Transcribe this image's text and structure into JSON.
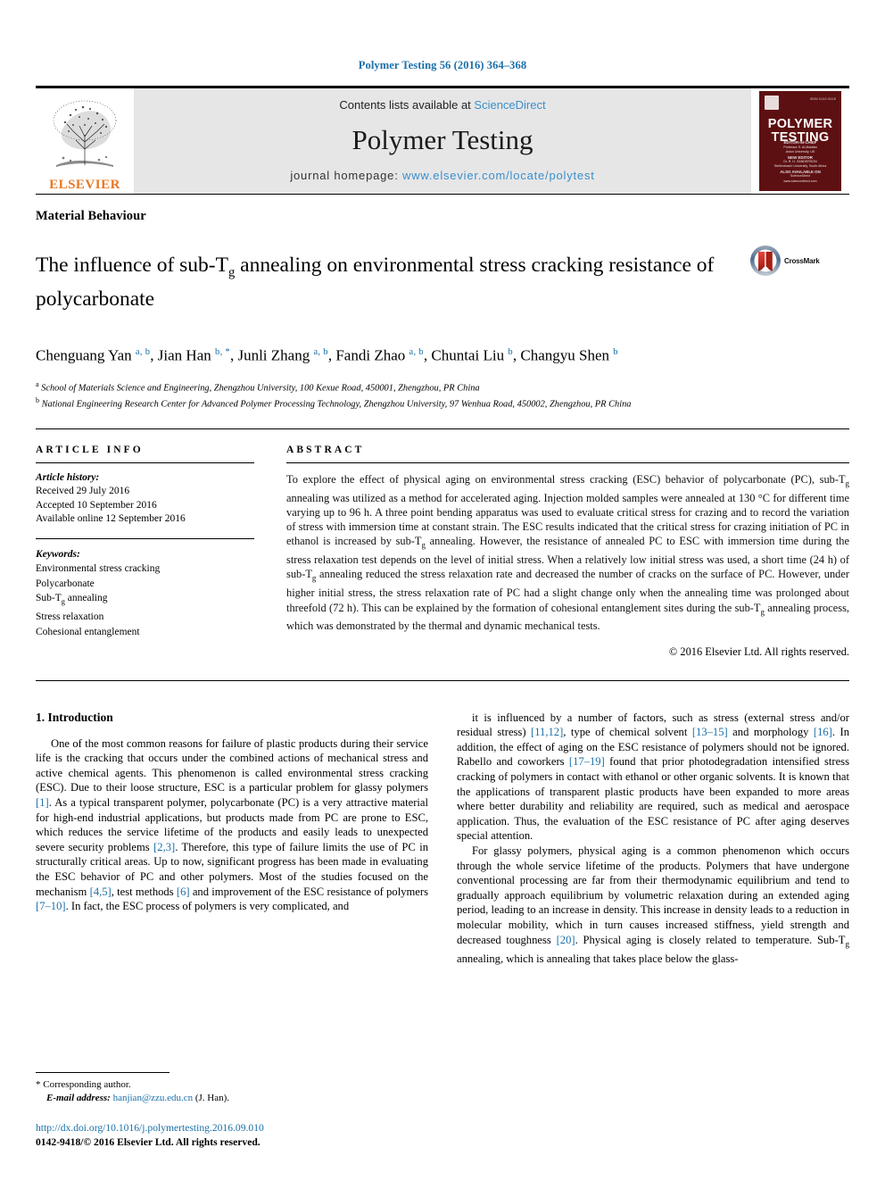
{
  "running_head": "Polymer Testing 56 (2016) 364–368",
  "masthead": {
    "elsevier_wordmark": "ELSEVIER",
    "contents_prefix": "Contents lists available at ",
    "sciencedirect": "ScienceDirect",
    "journal_title": "Polymer Testing",
    "homepage_prefix": "journal homepage: ",
    "homepage_url": "www.elsevier.com/locate/polytest",
    "cover": {
      "title_line1": "POLYMER",
      "title_line2": "TESTING",
      "issn_text": "ISSN 0142-9418",
      "credit1": "EDITOR-IN-CHIEF",
      "credit2": "Professor S. Al-Malaika",
      "credit3": "Aston University, UK",
      "credit4": "NEW EDITOR",
      "credit5": "Dr. R. D. SANDERSON",
      "credit6": "Stellenbosch University, South Africa",
      "credit7": "ALSO AVAILABLE ON",
      "credit8": "ScienceDirect",
      "credit9": "www.sciencedirect.com"
    }
  },
  "kicker": "Material Behaviour",
  "title": {
    "part1": "The influence of sub-T",
    "sub": "g",
    "part2": " annealing on environmental stress cracking resistance of polycarbonate"
  },
  "crossmark_label": "CrossMark",
  "authors": [
    {
      "name": "Chenguang Yan",
      "sup": "a, b",
      "sep": ", "
    },
    {
      "name": "Jian Han",
      "sup": "b, *",
      "sep": ", "
    },
    {
      "name": "Junli Zhang",
      "sup": "a, b",
      "sep": ", "
    },
    {
      "name": "Fandi Zhao",
      "sup": "a, b",
      "sep": ", "
    },
    {
      "name": "Chuntai Liu",
      "sup": "b",
      "sep": ", "
    },
    {
      "name": "Changyu Shen",
      "sup": "b",
      "sep": ""
    }
  ],
  "affiliations": [
    {
      "marker": "a",
      "text": "School of Materials Science and Engineering, Zhengzhou University, 100 Kexue Road, 450001, Zhengzhou, PR China"
    },
    {
      "marker": "b",
      "text": "National Engineering Research Center for Advanced Polymer Processing Technology, Zhengzhou University, 97 Wenhua Road, 450002, Zhengzhou, PR China"
    }
  ],
  "article_info": {
    "heading": "ARTICLE INFO",
    "history_label": "Article history:",
    "history": [
      "Received 29 July 2016",
      "Accepted 10 September 2016",
      "Available online 12 September 2016"
    ],
    "keywords_label": "Keywords:",
    "keywords": [
      "Environmental stress cracking",
      "Polycarbonate",
      "Sub-Tg annealing",
      "Stress relaxation",
      "Cohesional entanglement"
    ]
  },
  "abstract": {
    "heading": "ABSTRACT",
    "text_p1": "To explore the effect of physical aging on environmental stress cracking (ESC) behavior of polycarbonate (PC), sub-Tg annealing was utilized as a method for accelerated aging. Injection molded samples were annealed at 130 °C for different time varying up to 96 h. A three point bending apparatus was used to evaluate critical stress for crazing and to record the variation of stress with immersion time at constant strain. The ESC results indicated that the critical stress for crazing initiation of PC in ethanol is increased by sub-Tg annealing. However, the resistance of annealed PC to ESC with immersion time during the stress relaxation test depends on the level of initial stress. When a relatively low initial stress was used, a short time (24 h) of sub-Tg annealing reduced the stress relaxation rate and decreased the number of cracks on the surface of PC. However, under higher initial stress, the stress relaxation rate of PC had a slight change only when the annealing time was prolonged about threefold (72 h). This can be explained by the formation of cohesional entanglement sites during the sub-Tg annealing process, which was demonstrated by the thermal and dynamic mechanical tests.",
    "copyright": "© 2016 Elsevier Ltd. All rights reserved."
  },
  "body": {
    "section_heading": "1. Introduction",
    "left_paragraph": "One of the most common reasons for failure of plastic products during their service life is the cracking that occurs under the combined actions of mechanical stress and active chemical agents. This phenomenon is called environmental stress cracking (ESC). Due to their loose structure, ESC is a particular problem for glassy polymers [1]. As a typical transparent polymer, polycarbonate (PC) is a very attractive material for high-end industrial applications, but products made from PC are prone to ESC, which reduces the service lifetime of the products and easily leads to unexpected severe security problems [2,3]. Therefore, this type of failure limits the use of PC in structurally critical areas. Up to now, significant progress has been made in evaluating the ESC behavior of PC and other polymers. Most of the studies focused on the mechanism [4,5], test methods [6] and improvement of the ESC resistance of polymers [7–10]. In fact, the ESC process of polymers is very complicated, and",
    "right_paragraph_1": "it is influenced by a number of factors, such as stress (external stress and/or residual stress) [11,12], type of chemical solvent [13–15] and morphology [16]. In addition, the effect of aging on the ESC resistance of polymers should not be ignored. Rabello and coworkers [17–19] found that prior photodegradation intensified stress cracking of polymers in contact with ethanol or other organic solvents. It is known that the applications of transparent plastic products have been expanded to more areas where better durability and reliability are required, such as medical and aerospace application. Thus, the evaluation of the ESC resistance of PC after aging deserves special attention.",
    "right_paragraph_2": "For glassy polymers, physical aging is a common phenomenon which occurs through the whole service lifetime of the products. Polymers that have undergone conventional processing are far from their thermodynamic equilibrium and tend to gradually approach equilibrium by volumetric relaxation during an extended aging period, leading to an increase in density. This increase in density leads to a reduction in molecular mobility, which in turn causes increased stiffness, yield strength and decreased toughness [20]. Physical aging is closely related to temperature. Sub-Tg annealing, which is annealing that takes place below the glass-"
  },
  "footer": {
    "corresponding_author": "Corresponding author.",
    "email_label": "E-mail address:",
    "email": "hanjian@zzu.edu.cn",
    "email_owner": "(J. Han).",
    "doi": "http://dx.doi.org/10.1016/j.polymertesting.2016.09.010",
    "issn_line": "0142-9418/© 2016 Elsevier Ltd. All rights reserved."
  },
  "colors": {
    "link": "#1a6fa8",
    "sciencedirect": "#3a8fcc",
    "elsevier_orange": "#e87722",
    "cover_maroon": "#5d1012"
  }
}
